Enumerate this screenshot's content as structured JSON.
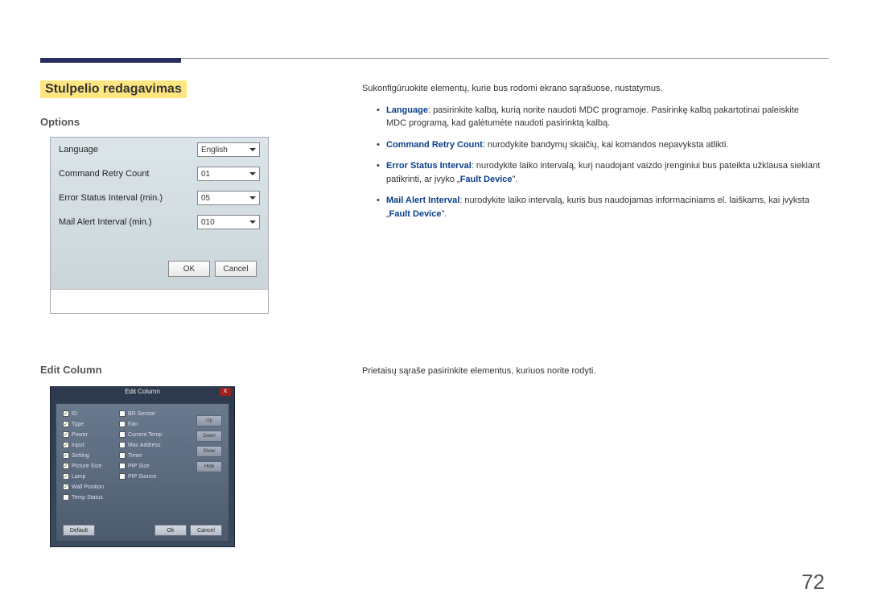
{
  "section_title": "Stulpelio redagavimas",
  "subsection_options": "Options",
  "subsection_edit": "Edit Column",
  "options_panel": {
    "language_label": "Language",
    "language_value": "English",
    "retry_label": "Command Retry Count",
    "retry_value": "01",
    "error_label": "Error Status Interval (min.)",
    "error_value": "05",
    "mail_label": "Mail Alert Interval (min.)",
    "mail_value": "010",
    "ok": "OK",
    "cancel": "Cancel"
  },
  "body": {
    "intro": "Sukonfigūruokite elementų, kurie bus rodomi ekrano sąrašuose, nustatymus.",
    "bullet1_term": "Language",
    "bullet1_text": ": pasirinkite kalbą, kurią norite naudoti MDC programoje. Pasirinkę kalbą pakartotinai paleiskite MDC programą, kad galėtumėte naudoti pasirinktą kalbą.",
    "bullet2_term": "Command Retry Count",
    "bullet2_text": ": nurodykite bandymų skaičių, kai komandos nepavyksta atlikti.",
    "bullet3_term": "Error Status Interval",
    "bullet3_text": ": nurodykite laiko intervalą, kurį naudojant vaizdo įrenginiui bus pateikta užklausa siekiant patikrinti, ar įvyko „",
    "bullet3_term2": "Fault Device",
    "bullet3_end": "\".",
    "bullet4_term": "Mail Alert Interval",
    "bullet4_text": ": nurodykite laiko intervalą, kuris bus naudojamas informaciniams el. laiškams, kai įvyksta „",
    "bullet4_term2": "Fault Device",
    "bullet4_end": "\"."
  },
  "edit_desc": "Prietaisų sąraše pasirinkite elementus, kuriuos norite rodyti.",
  "edit_panel": {
    "title": "Edit Column",
    "col1": [
      "ID",
      "Type",
      "Power",
      "Input",
      "Setting",
      "Picture Size",
      "Lamp",
      "Wall Position",
      "Temp Status"
    ],
    "col1_checked": [
      true,
      true,
      true,
      true,
      true,
      true,
      true,
      true,
      false
    ],
    "col2": [
      "BR Sensor",
      "Fan",
      "Current Temp",
      "Mac Address",
      "Timer",
      "PIP Size",
      "PIP Source"
    ],
    "col2_checked": [
      false,
      false,
      false,
      false,
      false,
      false,
      false
    ],
    "side_btns": [
      "Up",
      "Down",
      "Show",
      "Hide"
    ],
    "default": "Default",
    "ok": "Ok",
    "cancel": "Cancel"
  },
  "page_number": "72"
}
